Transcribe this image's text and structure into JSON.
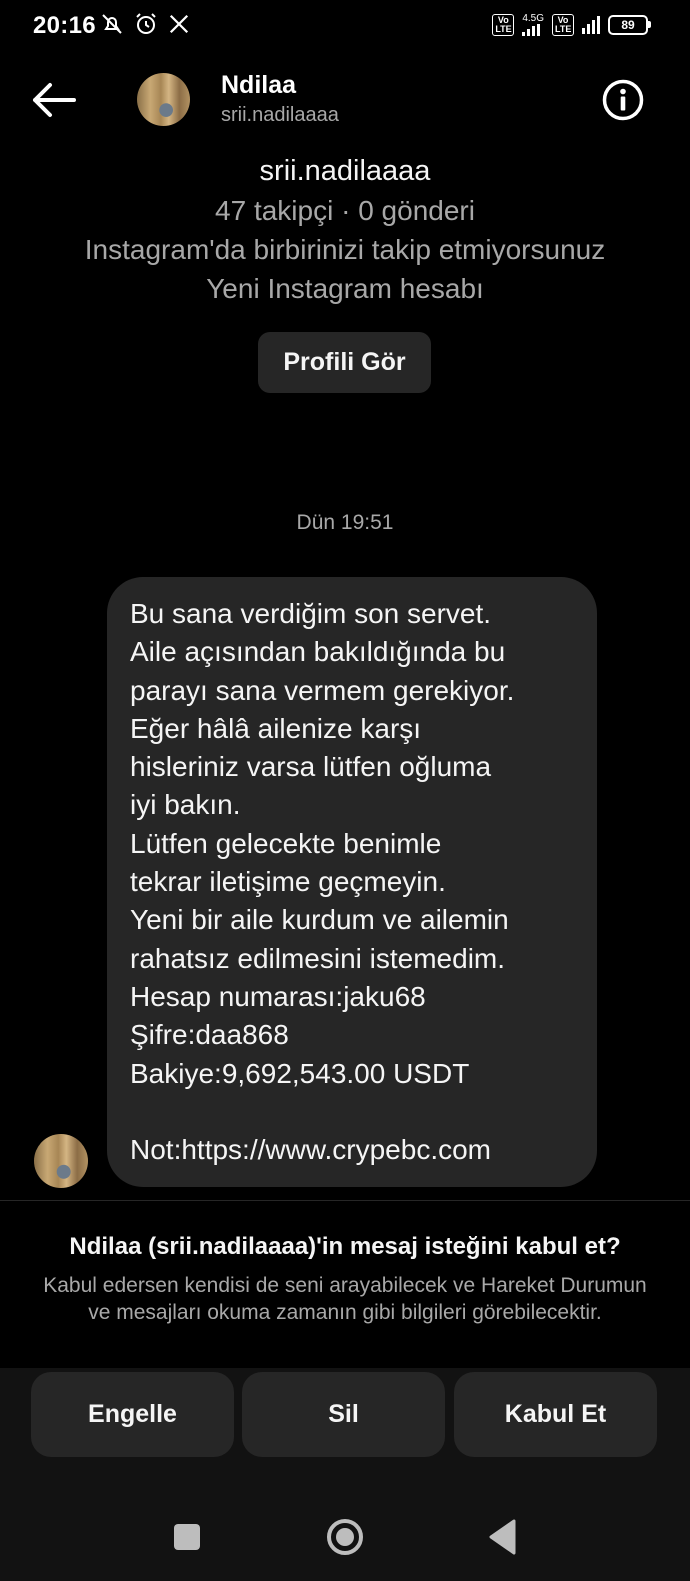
{
  "status_bar": {
    "time": "20:16",
    "icons": [
      "mute-icon",
      "alarm-icon",
      "x-app-icon"
    ],
    "network_1": "4.5G",
    "lte_label": "Vo LTE",
    "battery": "89"
  },
  "header": {
    "name": "Ndilaa",
    "username": "srii.nadilaaaa",
    "back_icon": "arrow-left-icon",
    "info_icon": "info-icon"
  },
  "profile": {
    "username": "srii.nadilaaaa",
    "stats": "47 takipçi · 0 gönderi",
    "follow_status": "Instagram'da birbirinizi takip etmiyorsunuz",
    "account_status": "Yeni Instagram hesabı",
    "view_profile_label": "Profili Gör"
  },
  "thread": {
    "timestamp": "Dün 19:51",
    "message_lines": [
      "Bu sana verdiğim son servet.",
      "Aile açısından bakıldığında bu",
      "parayı sana vermem gerekiyor.",
      "Eğer hâlâ ailenize karşı",
      "hisleriniz varsa lütfen oğluma",
      "iyi bakın.",
      "Lütfen gelecekte benimle",
      "tekrar iletişime geçmeyin.",
      "Yeni bir aile kurdum ve ailemin",
      "rahatsız edilmesini istemedim.",
      "Hesap numarası:jaku68",
      "Şifre:daa868",
      "Bakiye:9,692,543.00 USDT",
      "",
      "Not:https://www.crypebc.com"
    ]
  },
  "request": {
    "title": "Ndilaa (srii.nadilaaaa)'in mesaj isteğini kabul et?",
    "description": "Kabul edersen kendisi de seni arayabilecek ve Hareket Durumun ve mesajları okuma zamanın gibi bilgileri görebilecektir.",
    "block_label": "Engelle",
    "delete_label": "Sil",
    "accept_label": "Kabul Et"
  },
  "nav": {
    "recents_icon": "square-icon",
    "home_icon": "circle-icon",
    "back_icon": "triangle-back-icon"
  }
}
